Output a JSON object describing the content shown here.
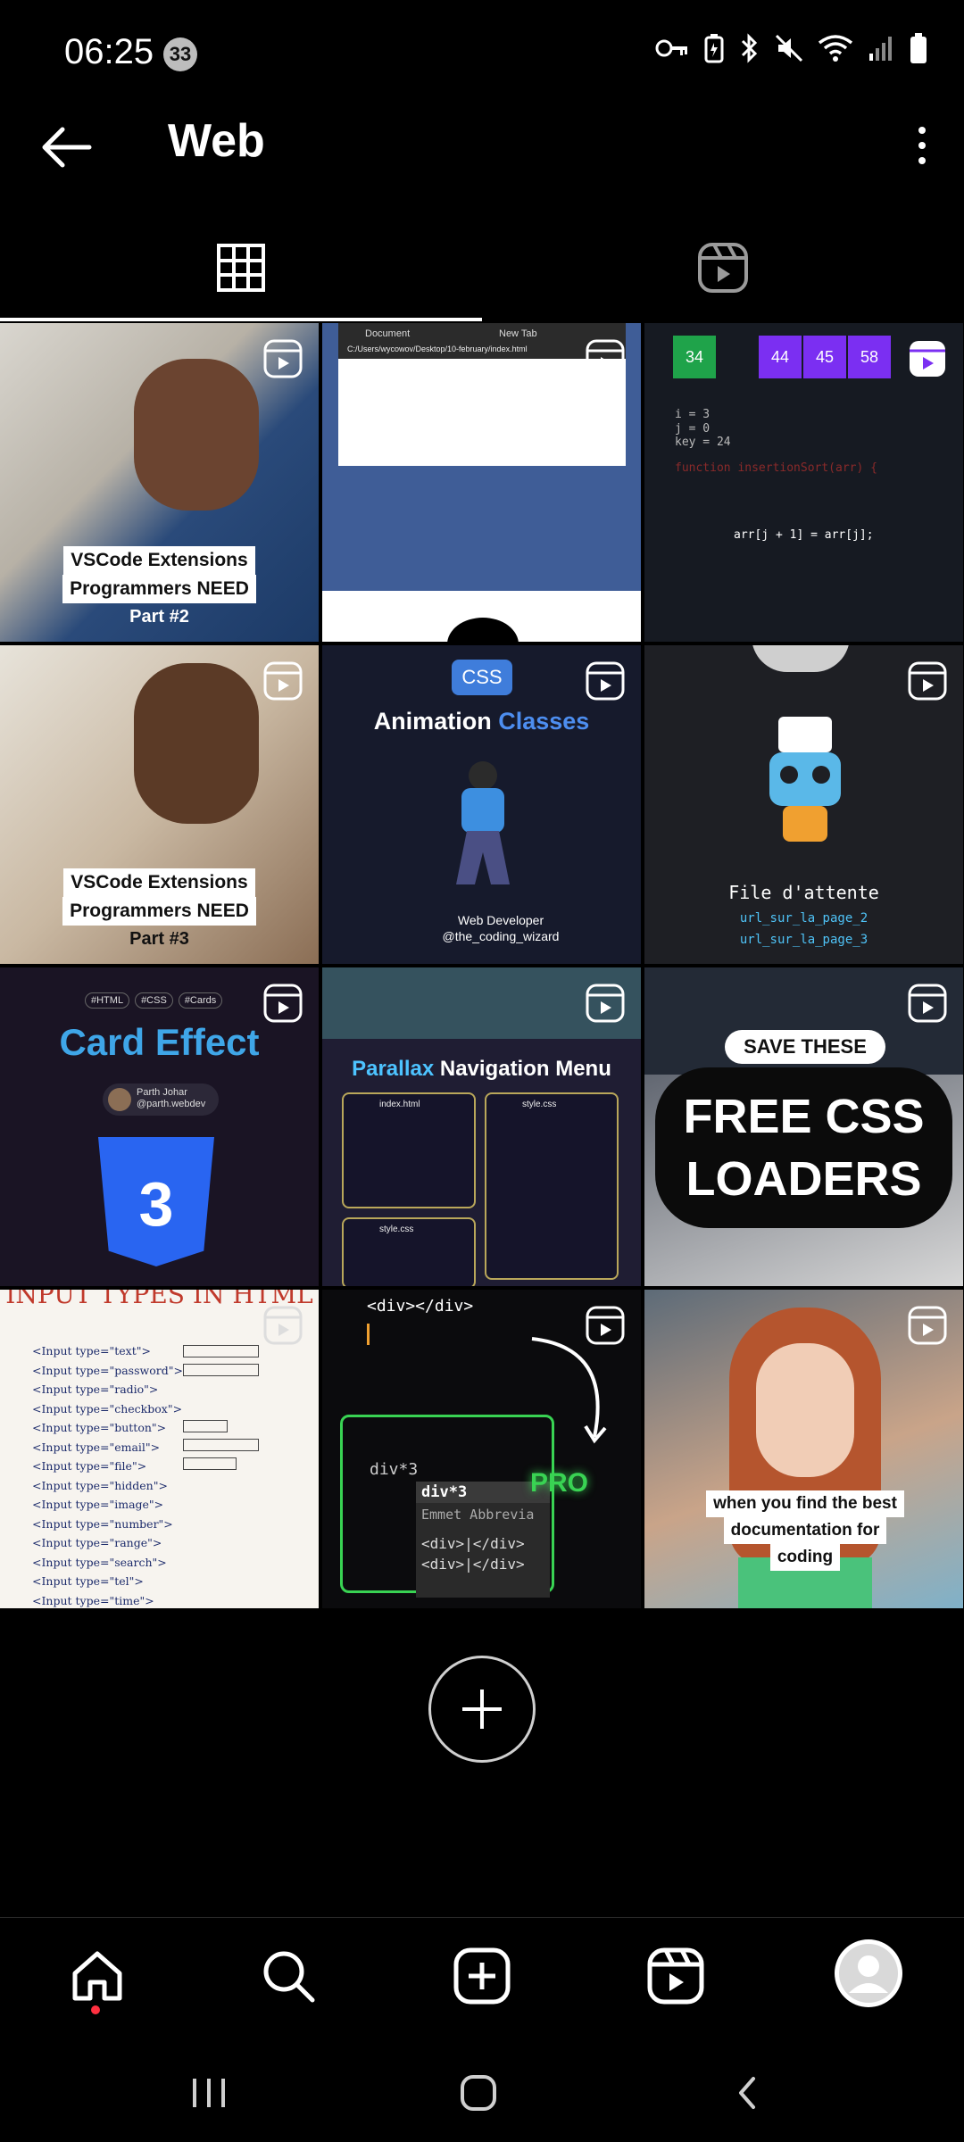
{
  "status_bar": {
    "time": "06:25",
    "notification_count": "33",
    "icons": [
      "key-icon",
      "battery-saver-icon",
      "bluetooth-icon",
      "mute-icon",
      "wifi-icon",
      "signal-icon",
      "battery-icon"
    ]
  },
  "header": {
    "title": "Web",
    "back_icon": "arrow-left-icon",
    "menu_icon": "more-vertical-icon"
  },
  "tabs": [
    {
      "name": "grid",
      "icon": "grid-icon",
      "active": true
    },
    {
      "name": "reels",
      "icon": "reels-icon",
      "active": false
    }
  ],
  "tiles": [
    {
      "caption_line1": "VSCode Extensions",
      "caption_line2": "Programmers NEED",
      "caption_line3": "Part #2"
    },
    {
      "browser_tab1": "Document",
      "browser_tab2": "New Tab",
      "url": "C:/Users/wycowov/Desktop/10-february/index.html"
    },
    {
      "num1": "34",
      "num2": "44",
      "num3": "45",
      "num4": "58",
      "code1": "i = 3",
      "code2": "j = 0",
      "code3": "key = 24",
      "code4": "function insertionSort(arr) {",
      "code5": "arr[j + 1] = arr[j];"
    },
    {
      "caption_line1": "VSCode Extensions",
      "caption_line2": "Programmers NEED",
      "caption_line3": "Part #3"
    },
    {
      "badge": "CSS",
      "title_part1": "Animation",
      "title_part2": "Classes",
      "author_line1": "Web Developer",
      "author_line2": "@the_coding_wizard"
    },
    {
      "title": "File d'attente",
      "link1": "url_sur_la_page_2",
      "link2": "url_sur_la_page_3"
    },
    {
      "tags": [
        "#HTML",
        "#CSS",
        "#Cards"
      ],
      "title": "Card Effect",
      "author_name": "Parth Johar",
      "author_handle": "@parth.webdev",
      "logo_text": "3"
    },
    {
      "title_part1": "Parallax",
      "title_part2": "Navigation Menu",
      "file1": "index.html",
      "file2": "style.css",
      "file3": "style.css"
    },
    {
      "line1": "SAVE THESE",
      "line2": "FREE CSS",
      "line3": "LOADERS"
    },
    {
      "title": "INPUT TYPES IN HTML",
      "rows": [
        "<Input type=\"text\">",
        "<Input type=\"password\">",
        "<Input type=\"radio\">",
        "<Input type=\"checkbox\">",
        "<Input type=\"button\">",
        "<Input type=\"email\">",
        "<Input type=\"file\">",
        "<Input type=\"hidden\">",
        "<Input type=\"image\">",
        "<Input type=\"number\">",
        "<Input type=\"range\">",
        "<Input type=\"search\">",
        "<Input type=\"tel\">",
        "<Input type=\"time\">"
      ]
    },
    {
      "code_top": "<div></div>",
      "code_input": "div*3",
      "suggest": "div*3",
      "suggest_desc": "Emmet Abbrevia",
      "result1": "<div>|</div>",
      "result2": "<div>|</div>",
      "badge": "PRO"
    },
    {
      "caption_line1": "when you find the best",
      "caption_line2": "documentation for",
      "caption_line3": "coding"
    }
  ],
  "add_button": {
    "icon": "plus-icon"
  },
  "bottom_nav": [
    {
      "name": "home",
      "icon": "home-icon"
    },
    {
      "name": "search",
      "icon": "search-icon"
    },
    {
      "name": "create",
      "icon": "plus-square-icon"
    },
    {
      "name": "reels",
      "icon": "reels-icon"
    },
    {
      "name": "profile",
      "icon": "avatar-icon"
    }
  ],
  "system_nav": [
    {
      "name": "recents",
      "icon": "recents-icon"
    },
    {
      "name": "home",
      "icon": "home-circle-icon"
    },
    {
      "name": "back",
      "icon": "chevron-left-icon"
    }
  ],
  "colors": {
    "background": "#000000",
    "accent_red": "#ff3040",
    "text": "#ffffff"
  }
}
